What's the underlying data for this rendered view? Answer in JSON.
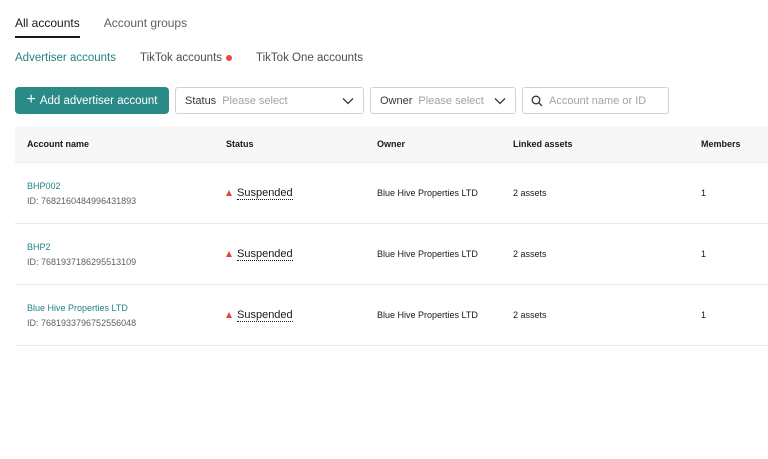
{
  "top_tabs": [
    {
      "label": "All accounts",
      "active": true
    },
    {
      "label": "Account groups",
      "active": false
    }
  ],
  "sub_tabs": [
    {
      "label": "Advertiser accounts",
      "active": true
    },
    {
      "label": "TikTok accounts",
      "active": false,
      "has_notification_dot": true
    },
    {
      "label": "TikTok One accounts",
      "active": false
    }
  ],
  "toolbar": {
    "add_button": "Add advertiser account",
    "status_filter": {
      "label": "Status",
      "placeholder": "Please select"
    },
    "owner_filter": {
      "label": "Owner",
      "placeholder": "Please select"
    },
    "search_placeholder": "Account name or ID"
  },
  "table": {
    "columns": [
      "Account name",
      "Status",
      "Owner",
      "Linked assets",
      "Members"
    ],
    "rows": [
      {
        "name": "BHP002",
        "id": "ID: 7682160484996431893",
        "status": "Suspended",
        "owner": "Blue Hive Properties LTD",
        "linked_assets": "2 assets",
        "members": "1"
      },
      {
        "name": "BHP2",
        "id": "ID: 7681937186295513109",
        "status": "Suspended",
        "owner": "Blue Hive Properties LTD",
        "linked_assets": "2 assets",
        "members": "1"
      },
      {
        "name": "Blue Hive Properties LTD",
        "id": "ID: 7681933796752556048",
        "status": "Suspended",
        "owner": "Blue Hive Properties LTD",
        "linked_assets": "2 assets",
        "members": "1"
      }
    ]
  },
  "colors": {
    "accent": "#2a8a87",
    "link": "#218383",
    "warning": "#e0453a",
    "notification": "#f04545"
  }
}
